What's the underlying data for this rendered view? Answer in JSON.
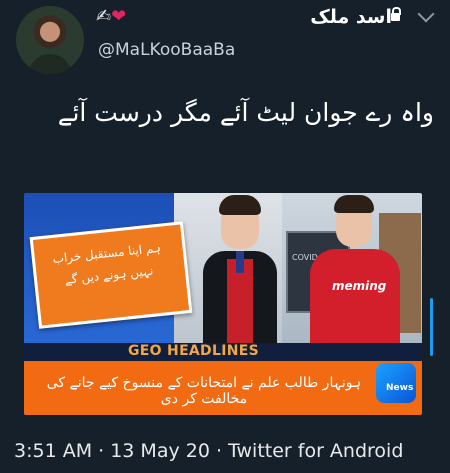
{
  "author": {
    "display_name": "اسد ملک",
    "emojis": [
      "✍",
      "❤"
    ],
    "handle": "@MaLKooBaaBa"
  },
  "tweet": {
    "text": "واہ رے جوان لیٹ آئے مگر درست آئے"
  },
  "media": {
    "card_text": "ہم اپنا مستقبل خراب نہیں ہونے دیں گے",
    "headline_prefix": "GEO",
    "headline_suffix": "HEADLINES",
    "ticker_text": "ہونہار طالب علم نے امتحانات کے منسوخ کیے جانے کی مخالفت کر دی",
    "shirt_text": "meming",
    "board_text": "COVID",
    "logo_text": "News"
  },
  "meta": {
    "timestamp": "3:51 AM · 13 May 20 · Twitter for Android"
  },
  "colors": {
    "background": "#15202b",
    "accent": "#1d9bf0",
    "heart": "#e0245e",
    "ticker": "#f26a12"
  }
}
